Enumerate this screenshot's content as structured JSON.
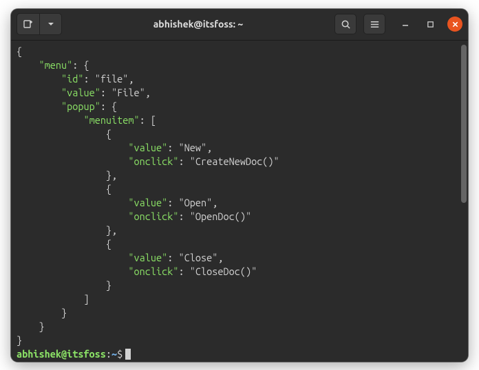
{
  "window": {
    "title": "abhishek@itsfoss: ~"
  },
  "terminal": {
    "lines": [
      "{",
      "    \"menu\": {",
      "        \"id\": \"file\",",
      "        \"value\": \"File\",",
      "        \"popup\": {",
      "            \"menuitem\": [",
      "                {",
      "                    \"value\": \"New\",",
      "                    \"onclick\": \"CreateNewDoc()\"",
      "                },",
      "                {",
      "                    \"value\": \"Open\",",
      "                    \"onclick\": \"OpenDoc()\"",
      "                },",
      "                {",
      "                    \"value\": \"Close\",",
      "                    \"onclick\": \"CloseDoc()\"",
      "                }",
      "            ]",
      "        }",
      "    }",
      "}"
    ],
    "prompt": {
      "userhost": "abhishek@itsfoss",
      "separator": ":",
      "path": "~",
      "symbol": "$"
    }
  }
}
